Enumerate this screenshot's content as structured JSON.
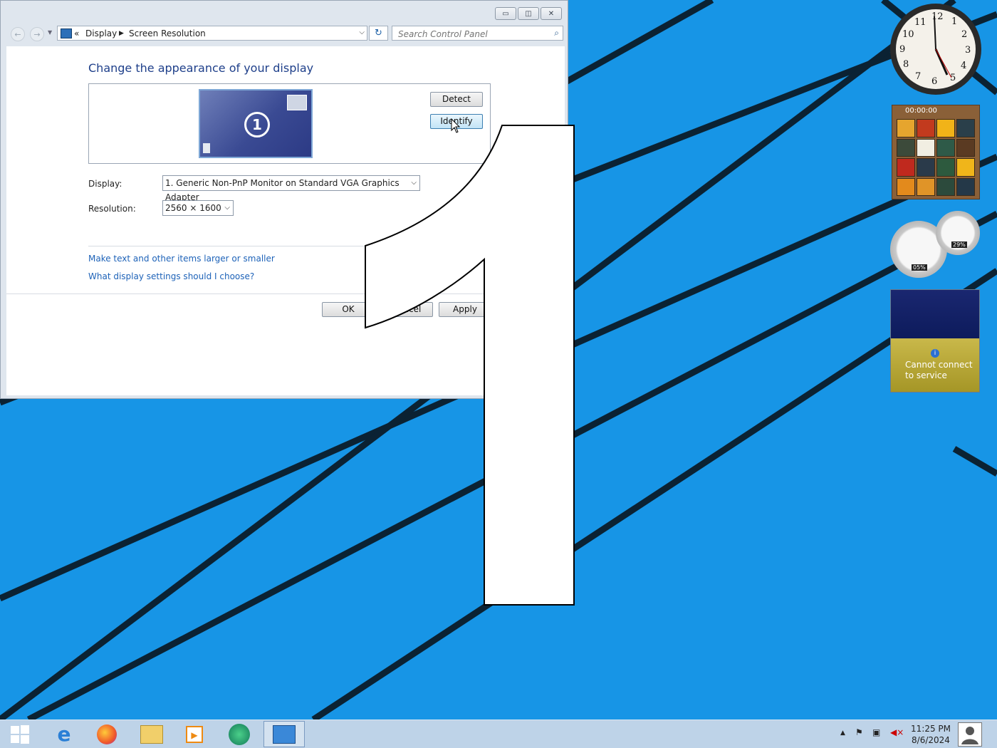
{
  "window": {
    "breadcrumb_sep": "«",
    "breadcrumb": [
      "Display",
      "Screen Resolution"
    ],
    "search_placeholder": "Search Control Panel",
    "heading": "Change the appearance of your display",
    "monitor_number": "1",
    "detect_label": "Detect",
    "identify_label": "Identify",
    "display_label": "Display:",
    "display_value": "1. Generic Non-PnP Monitor on Standard VGA Graphics Adapter",
    "resolution_label": "Resolution:",
    "resolution_value": "2560 × 1600",
    "link1": "Make text and other items larger or smaller",
    "link2": "What display settings should I choose?",
    "ok_label": "OK",
    "cancel_label": "Cancel",
    "apply_label": "Apply"
  },
  "identify_overlay": "1",
  "gadgets": {
    "clock_numbers": [
      "12",
      "1",
      "2",
      "3",
      "4",
      "5",
      "6",
      "7",
      "8",
      "9",
      "10",
      "11"
    ],
    "puzzle_timer": "00:00:00",
    "cpu_percent": "05%",
    "mem_percent": "29%",
    "weather_message_line1": "Cannot connect",
    "weather_message_line2": "to service"
  },
  "taskbar": {
    "items": [
      "start",
      "internet-explorer",
      "firefox",
      "file-explorer",
      "media-player",
      "browser-2",
      "control-panel"
    ],
    "time": "11:25 PM",
    "date": "8/6/2024"
  },
  "colors": {
    "desktop": "#1795e6",
    "taskbar": "#bed3e8",
    "link": "#1d62b8",
    "heading": "#1e3f8a"
  }
}
